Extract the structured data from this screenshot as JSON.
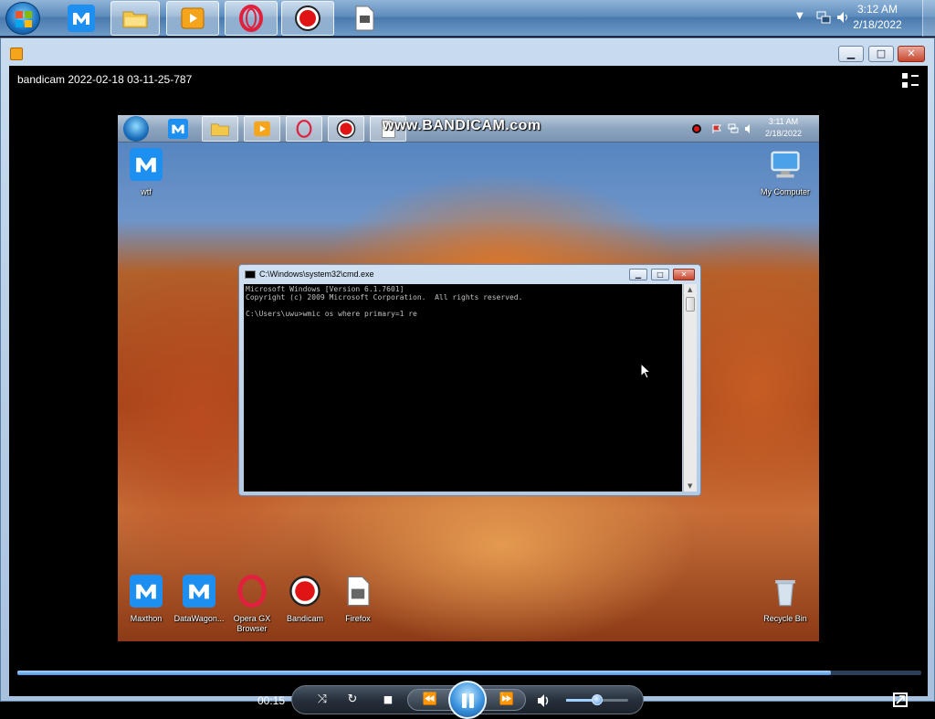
{
  "taskbar": {
    "clock_time": "3:12 AM",
    "clock_date": "2/18/2022",
    "apps": [
      "maxthon-icon",
      "explorer-icon",
      "media-player-icon",
      "opera-gx-icon",
      "bandicam-icon",
      "file-icon"
    ]
  },
  "player": {
    "video_title": "bandicam 2022-02-18 03-11-25-787",
    "current_time": "00:15",
    "progress": 0.9,
    "volume": 0.5
  },
  "recording": {
    "watermark": "www.BANDICAM.com",
    "tray_time": "3:11 AM",
    "tray_date": "2/18/2022",
    "desktop_icons": {
      "top_left": "wtf",
      "top_right": "My Computer",
      "bottom": [
        "Maxthon",
        "DataWagon...",
        "Opera GX Browser",
        "Bandicam",
        "Firefox"
      ],
      "recycle": "Recycle Bin"
    },
    "cmd": {
      "title": "C:\\Windows\\system32\\cmd.exe",
      "lines": [
        "Microsoft Windows [Version 6.1.7601]",
        "Copyright (c) 2009 Microsoft Corporation.  All rights reserved.",
        "",
        "C:\\Users\\uwu>wmic os where primary=1 re"
      ]
    }
  },
  "colors": {
    "accent": "#3a93df",
    "console_bg": "#000000",
    "console_text": "#c0c0c0"
  }
}
